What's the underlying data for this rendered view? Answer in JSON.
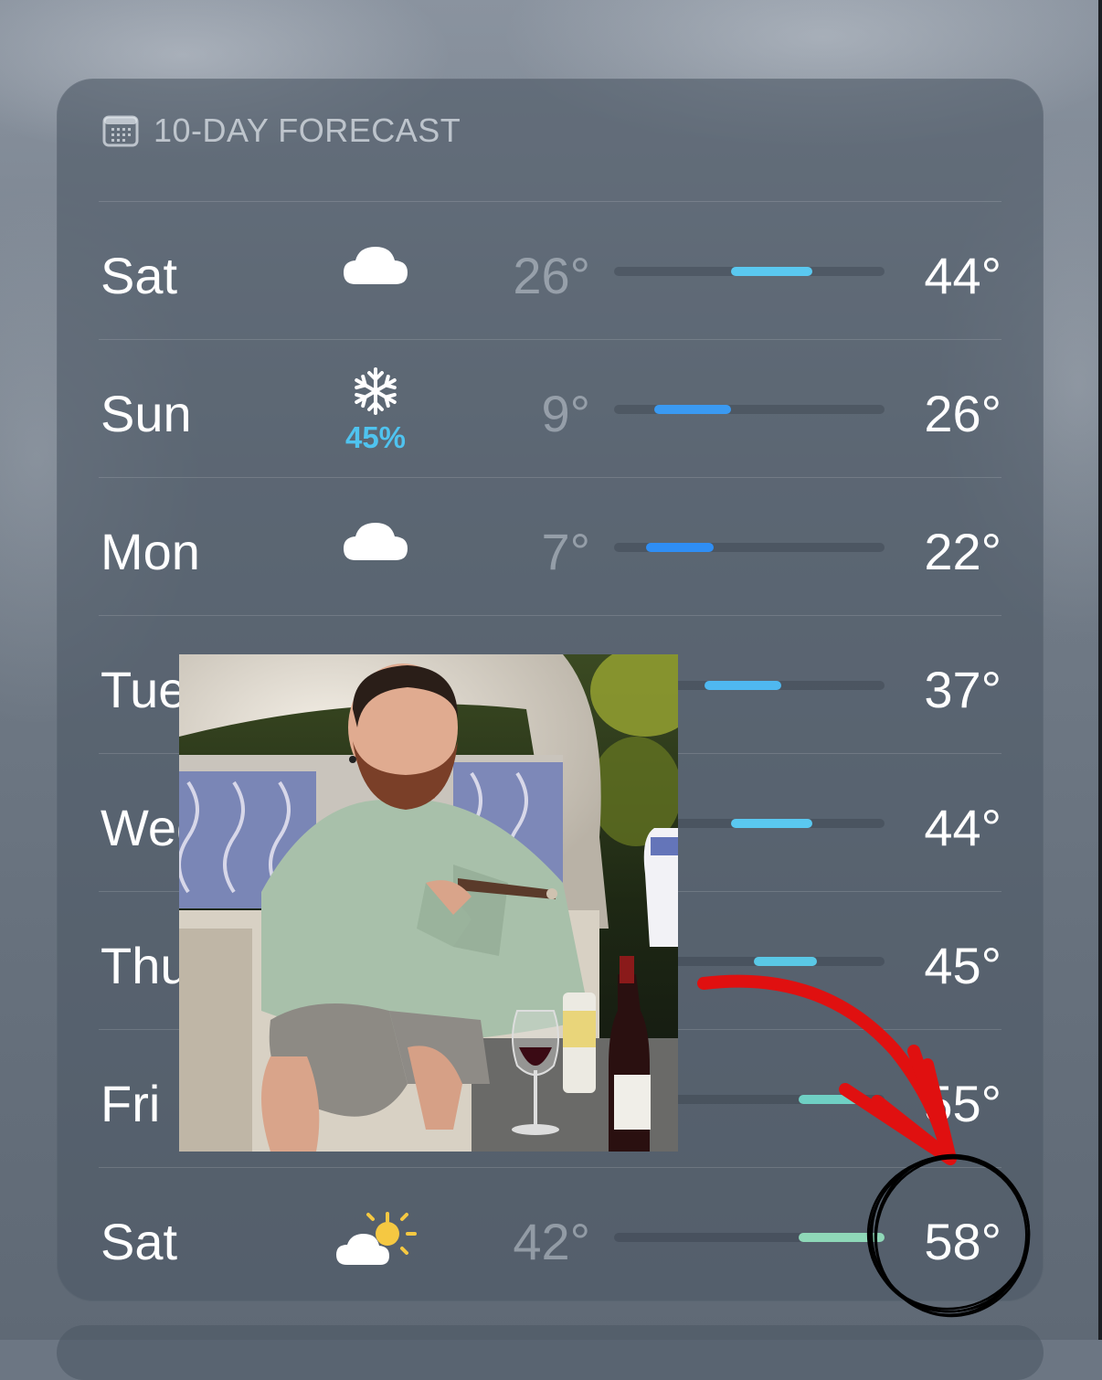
{
  "forecast": {
    "title": "10-DAY FORECAST",
    "header_icon": "calendar-icon",
    "range": {
      "min": 0,
      "max": 60
    },
    "days": [
      {
        "day": "Sat",
        "icon": "cloud-icon",
        "low": "26°",
        "high": "44°",
        "bar_low": 26,
        "bar_high": 44,
        "bar_color": "#5ac8f0"
      },
      {
        "day": "Sun",
        "icon": "snowflake-icon",
        "precip": "45%",
        "low": "9°",
        "high": "26°",
        "bar_low": 9,
        "bar_high": 26,
        "bar_color": "#3a9af2"
      },
      {
        "day": "Mon",
        "icon": "cloud-icon",
        "low": "7°",
        "high": "22°",
        "bar_low": 7,
        "bar_high": 22,
        "bar_color": "#2f8ef4"
      },
      {
        "day": "Tue",
        "icon": "cloud-icon",
        "low": "",
        "high": "37°",
        "bar_low": 20,
        "bar_high": 37,
        "bar_color": "#4fb8f0"
      },
      {
        "day": "Wed",
        "icon": "cloud-icon",
        "low": "",
        "high": "44°",
        "bar_low": 26,
        "bar_high": 44,
        "bar_color": "#5ac8f0"
      },
      {
        "day": "Thu",
        "icon": "cloud-icon",
        "low": "",
        "high": "45°",
        "bar_low": 31,
        "bar_high": 45,
        "bar_color": "#5ac8e6"
      },
      {
        "day": "Fri",
        "icon": "cloud-icon",
        "low": "",
        "high": "55°",
        "bar_low": 41,
        "bar_high": 55,
        "bar_color": "#6fd0c4"
      },
      {
        "day": "Sat",
        "icon": "partly-sunny-icon",
        "low": "42°",
        "high": "58°",
        "bar_low": 41,
        "bar_high": 60,
        "bar_color": "#8fd8b8"
      }
    ]
  },
  "overlay_photo": {
    "icon": "photo-person-icon"
  },
  "annotation": {
    "arrow_color": "#e01010",
    "circle_color": "#000000"
  }
}
